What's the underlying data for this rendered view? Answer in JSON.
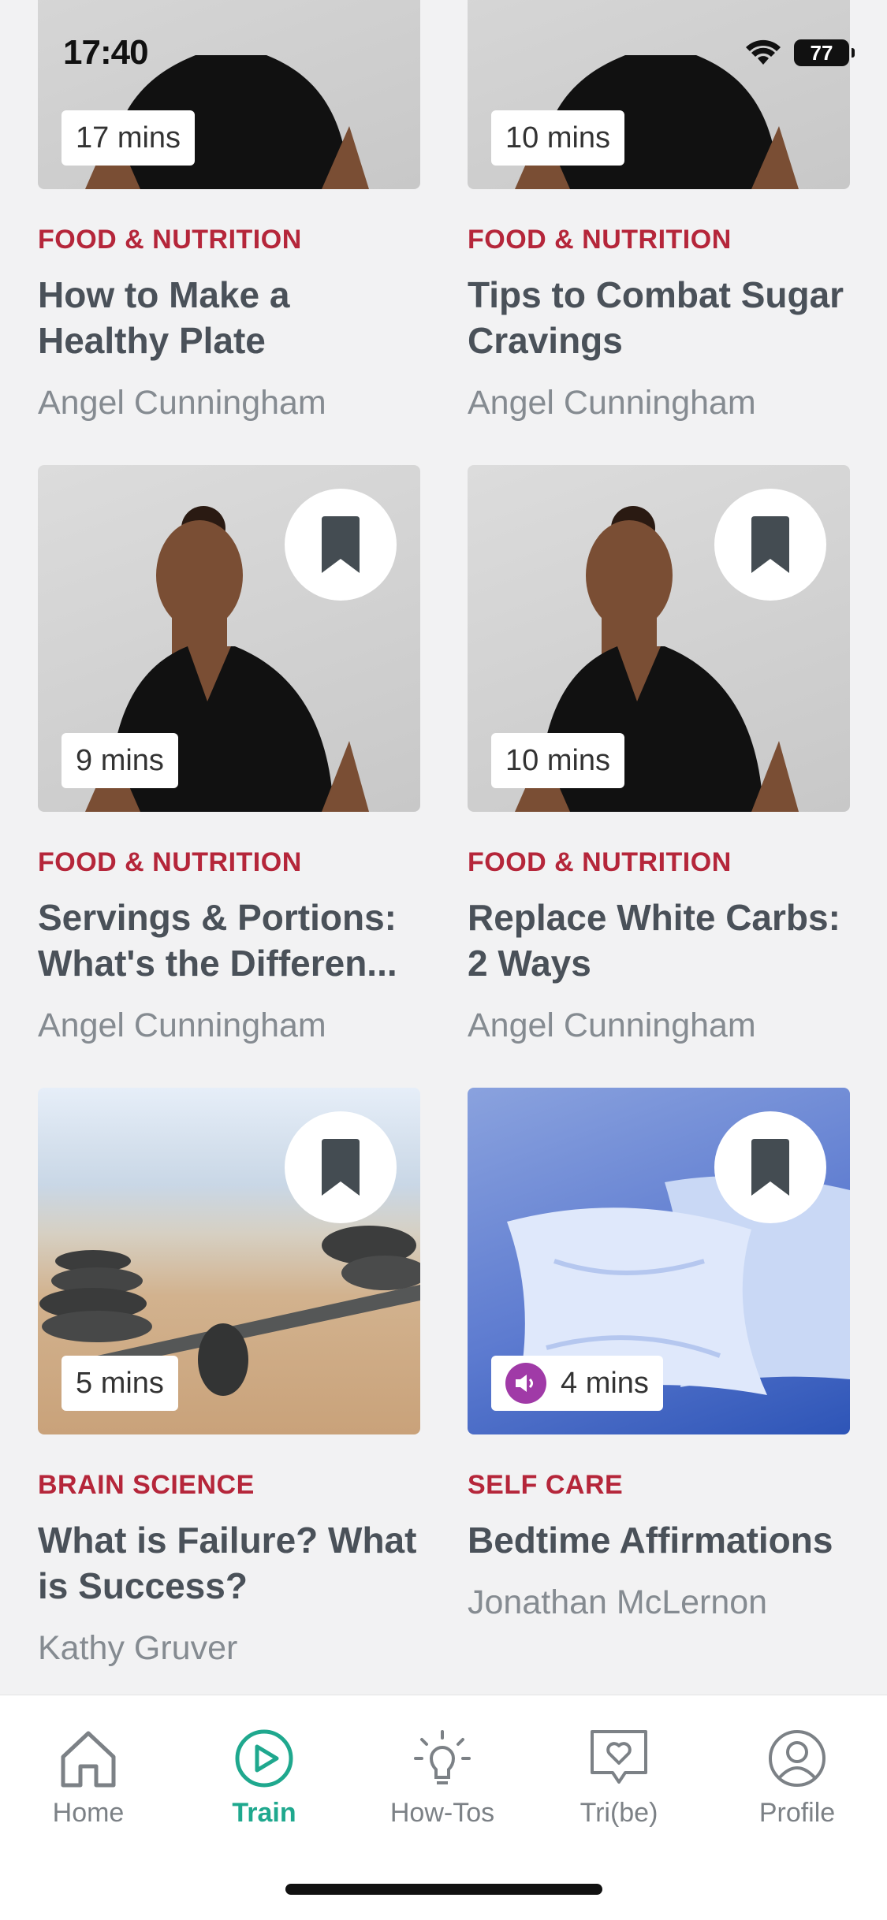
{
  "status_bar": {
    "time": "17:40",
    "battery": "77"
  },
  "cards": [
    {
      "duration": "17 mins",
      "category": "FOOD & NUTRITION",
      "title": "How to Make a Healthy Plate",
      "author": "Angel Cunningham"
    },
    {
      "duration": "10 mins",
      "category": "FOOD & NUTRITION",
      "title": "Tips to Combat Sugar Cravings",
      "author": "Angel Cunningham"
    },
    {
      "duration": "9 mins",
      "category": "FOOD & NUTRITION",
      "title": "Servings & Portions: What's the Differen...",
      "author": "Angel Cunningham"
    },
    {
      "duration": "10 mins",
      "category": "FOOD & NUTRITION",
      "title": "Replace White Carbs: 2 Ways",
      "author": "Angel Cunningham"
    },
    {
      "duration": "5 mins",
      "category": "BRAIN SCIENCE",
      "title": "What is Failure? What is Success?",
      "author": "Kathy Gruver"
    },
    {
      "duration": "4 mins",
      "category": "SELF CARE",
      "title": "Bedtime Affirmations",
      "author": "Jonathan McLernon"
    }
  ],
  "nav": {
    "home": "Home",
    "train": "Train",
    "howtos": "How-Tos",
    "tribe": "Tri(be)",
    "profile": "Profile"
  },
  "colors": {
    "accent": "#1fa88e",
    "category": "#b5263a"
  }
}
